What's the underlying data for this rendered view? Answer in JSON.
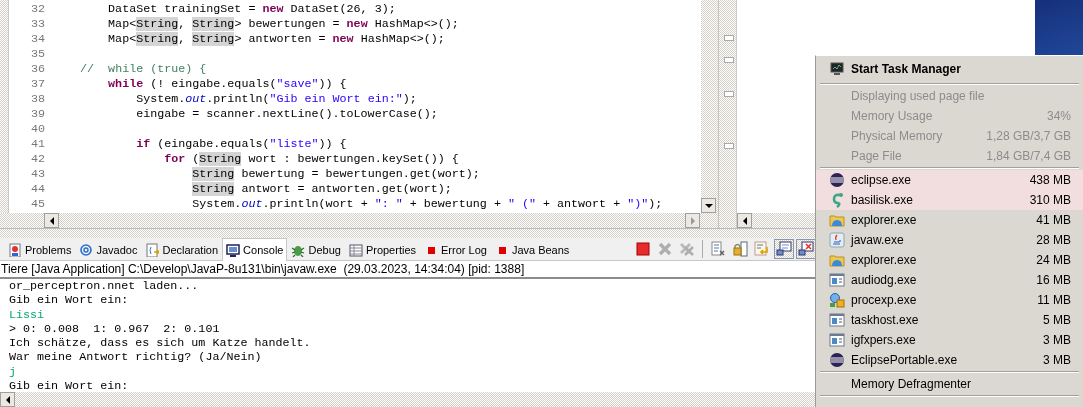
{
  "editor": {
    "lines": [
      {
        "number": "32",
        "tokens": [
          {
            "kind": "plain",
            "text": "        DataSet trainingSet = "
          },
          {
            "kind": "keyword",
            "text": "new"
          },
          {
            "kind": "plain",
            "text": " DataSet(26, 3);"
          }
        ]
      },
      {
        "number": "33",
        "tokens": [
          {
            "kind": "plain",
            "text": "        Map<"
          },
          {
            "kind": "occurrence",
            "text": "String"
          },
          {
            "kind": "plain",
            "text": ", "
          },
          {
            "kind": "occurrence",
            "text": "String"
          },
          {
            "kind": "plain",
            "text": "> bewertungen = "
          },
          {
            "kind": "keyword",
            "text": "new"
          },
          {
            "kind": "plain",
            "text": " HashMap<>();"
          }
        ]
      },
      {
        "number": "34",
        "tokens": [
          {
            "kind": "plain",
            "text": "        Map<"
          },
          {
            "kind": "occurrence",
            "text": "String"
          },
          {
            "kind": "plain",
            "text": ", "
          },
          {
            "kind": "occurrence",
            "text": "String"
          },
          {
            "kind": "plain",
            "text": "> antworten = "
          },
          {
            "kind": "keyword",
            "text": "new"
          },
          {
            "kind": "plain",
            "text": " HashMap<>();"
          }
        ]
      },
      {
        "number": "35"
      },
      {
        "number": "36",
        "tokens": [
          {
            "kind": "comment",
            "text": "    //  while (true) {"
          }
        ]
      },
      {
        "number": "37",
        "tokens": [
          {
            "kind": "keyword",
            "text": "        while"
          },
          {
            "kind": "plain",
            "text": " (! eingabe.equals("
          },
          {
            "kind": "string",
            "text": "\"save\""
          },
          {
            "kind": "plain",
            "text": ")) {"
          }
        ]
      },
      {
        "number": "38",
        "tokens": [
          {
            "kind": "plain",
            "text": "            System."
          },
          {
            "kind": "static",
            "text": "out"
          },
          {
            "kind": "plain",
            "text": ".println("
          },
          {
            "kind": "string",
            "text": "\"Gib ein Wort ein:\""
          },
          {
            "kind": "plain",
            "text": ");"
          }
        ]
      },
      {
        "number": "39",
        "tokens": [
          {
            "kind": "plain",
            "text": "            eingabe = scanner.nextLine().toLowerCase();"
          }
        ]
      },
      {
        "number": "40"
      },
      {
        "number": "41",
        "tokens": [
          {
            "kind": "keyword",
            "text": "            if"
          },
          {
            "kind": "plain",
            "text": " (eingabe.equals("
          },
          {
            "kind": "string",
            "text": "\"liste\""
          },
          {
            "kind": "plain",
            "text": ")) {"
          }
        ]
      },
      {
        "number": "42",
        "tokens": [
          {
            "kind": "keyword",
            "text": "                for"
          },
          {
            "kind": "plain",
            "text": " ("
          },
          {
            "kind": "occurrence",
            "text": "String"
          },
          {
            "kind": "plain",
            "text": " wort : bewertungen.keySet()) {"
          }
        ]
      },
      {
        "number": "43",
        "tokens": [
          {
            "kind": "occurrence",
            "text": "                    String"
          },
          {
            "kind": "plain",
            "text": " bewertung = bewertungen.get(wort);"
          }
        ]
      },
      {
        "number": "44",
        "tokens": [
          {
            "kind": "occurrence",
            "text": "                    String"
          },
          {
            "kind": "plain",
            "text": " antwort = antworten.get(wort);"
          }
        ]
      },
      {
        "number": "45",
        "tokens": [
          {
            "kind": "plain",
            "text": "                    System."
          },
          {
            "kind": "static",
            "text": "out"
          },
          {
            "kind": "plain",
            "text": ".println(wort + "
          },
          {
            "kind": "string",
            "text": "\": \""
          },
          {
            "kind": "plain",
            "text": " + bewertung + "
          },
          {
            "kind": "string",
            "text": "\" (\""
          },
          {
            "kind": "plain",
            "text": " + antwort + "
          },
          {
            "kind": "string",
            "text": "\")\""
          },
          {
            "kind": "plain",
            "text": ");"
          }
        ]
      }
    ]
  },
  "bottom_panel": {
    "tabs": [
      {
        "label": "Problems",
        "kind": "problems",
        "selected": false
      },
      {
        "label": "Javadoc",
        "kind": "javadoc",
        "selected": false
      },
      {
        "label": "Declaration",
        "kind": "declaration",
        "selected": false
      },
      {
        "label": "Console",
        "kind": "console",
        "selected": true
      },
      {
        "label": "Debug",
        "kind": "debug",
        "selected": false
      },
      {
        "label": "Properties",
        "kind": "properties",
        "selected": false
      },
      {
        "label": "Error Log",
        "kind": "view",
        "selected": false
      },
      {
        "label": "Java Beans",
        "kind": "view",
        "selected": false
      }
    ],
    "toolbar": [
      {
        "kind": "terminate",
        "disabled": false,
        "pressed": false
      },
      {
        "kind": "remove",
        "disabled": true,
        "pressed": false
      },
      {
        "kind": "remove-all",
        "disabled": true,
        "pressed": false
      },
      {
        "kind": "clear",
        "disabled": false,
        "pressed": false
      },
      {
        "kind": "lock",
        "disabled": false,
        "pressed": false
      },
      {
        "kind": "wrap",
        "disabled": false,
        "pressed": false
      },
      {
        "kind": "pin",
        "disabled": false,
        "pressed": true
      },
      {
        "kind": "display",
        "disabled": false,
        "pressed": true
      }
    ],
    "console": {
      "process_title": "Tiere [Java Application] C:\\Develop\\JavaP-8u131\\bin\\javaw.exe  (29.03.2023, 14:34:04) [pid: 1388]",
      "lines": [
        {
          "kind": "output",
          "text": "or_perceptron.nnet laden..."
        },
        {
          "kind": "output",
          "text": "Gib ein Wort ein:"
        },
        {
          "kind": "input",
          "text": "Lissi"
        },
        {
          "kind": "output",
          "text": "> 0: 0.008  1: 0.967  2: 0.101"
        },
        {
          "kind": "output",
          "text": "Ich schätze, dass es sich um Katze handelt."
        },
        {
          "kind": "output",
          "text": "War meine Antwort richtig? (Ja/Nein)"
        },
        {
          "kind": "input",
          "text": "j"
        },
        {
          "kind": "output",
          "text": "Gib ein Wort ein:"
        }
      ]
    }
  },
  "task_menu": {
    "header": "Start Task Manager",
    "info": [
      {
        "label": "Displaying used page file",
        "disabled": true
      },
      {
        "label": "Memory Usage",
        "value": "34%",
        "disabled": true
      },
      {
        "label": "Physical Memory",
        "value": "1,28 GB/3,7 GB",
        "disabled": true
      },
      {
        "label": "Page File",
        "value": "1,84 GB/7,4 GB",
        "disabled": true
      }
    ],
    "processes": [
      {
        "name": "eclipse.exe",
        "size": "438 MB",
        "kind": "eclipse",
        "highlighted": true
      },
      {
        "name": "basilisk.exe",
        "size": "310 MB",
        "kind": "basilisk",
        "highlighted": true
      },
      {
        "name": "explorer.exe",
        "size": "41 MB",
        "kind": "explorer",
        "highlighted": false
      },
      {
        "name": "javaw.exe",
        "size": "28 MB",
        "kind": "java",
        "highlighted": false
      },
      {
        "name": "explorer.exe",
        "size": "24 MB",
        "kind": "explorer",
        "highlighted": false
      },
      {
        "name": "audiodg.exe",
        "size": "16 MB",
        "kind": "service",
        "highlighted": false
      },
      {
        "name": "procexp.exe",
        "size": "11 MB",
        "kind": "procexp",
        "highlighted": false
      },
      {
        "name": "taskhost.exe",
        "size": "5 MB",
        "kind": "service",
        "highlighted": false
      },
      {
        "name": "igfxpers.exe",
        "size": "3 MB",
        "kind": "service",
        "highlighted": false
      },
      {
        "name": "EclipsePortable.exe",
        "size": "3 MB",
        "kind": "eclipse",
        "highlighted": false
      }
    ],
    "footer": "Memory Defragmenter"
  }
}
